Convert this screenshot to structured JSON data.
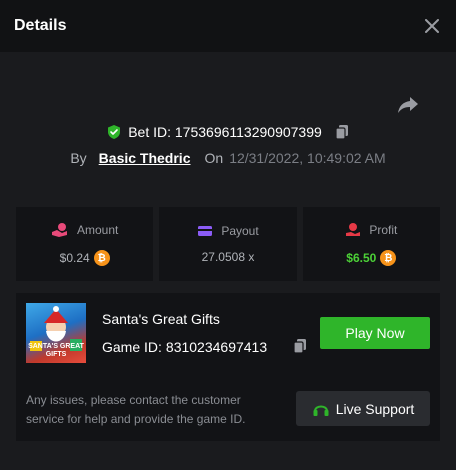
{
  "header": {
    "title": "Details",
    "close_icon": "close-icon"
  },
  "bet": {
    "label": "Bet ID: 1753696113290907399",
    "by_label": "By",
    "user": "Basic Thedric",
    "on_label": "On",
    "timestamp": "12/31/2022, 10:49:02 AM"
  },
  "stats": {
    "amount": {
      "label": "Amount",
      "value": "$0.24",
      "icon": "coins-hand-icon"
    },
    "payout": {
      "label": "Payout",
      "value": "27.0508 x",
      "icon": "card-icon"
    },
    "profit": {
      "label": "Profit",
      "value": "$6.50",
      "icon": "profit-icon"
    }
  },
  "coin_symbol": "₿",
  "game": {
    "thumbnail_caption": "SANTA'S GREAT GIFTS",
    "name": "Santa's Great Gifts",
    "id_label": "Game ID:",
    "id_value": "8310234697413",
    "play_label": "Play Now"
  },
  "support": {
    "note": "Any issues, please contact the customer service for help and provide the game ID.",
    "button_label": "Live Support"
  },
  "colors": {
    "accent_green": "#2fb52a",
    "profit_green": "#4cd137",
    "coin_orange": "#f7931a",
    "amount_pink": "#e84a7a",
    "payout_purple": "#8b5cf6",
    "profit_red": "#e63946"
  }
}
